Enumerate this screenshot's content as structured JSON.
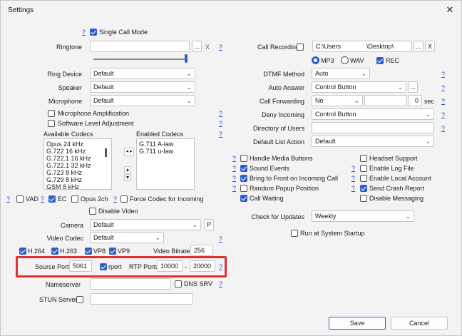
{
  "window": {
    "title": "Settings",
    "close_glyph": "✕"
  },
  "help_glyph": "?",
  "single_call_mode": {
    "label": "Single Call Mode",
    "checked": true
  },
  "ringtone": {
    "label": "Ringtone",
    "value": "",
    "browse": "...",
    "clear": "X"
  },
  "ring_device": {
    "label": "Ring Device",
    "value": "Default"
  },
  "speaker": {
    "label": "Speaker",
    "value": "Default"
  },
  "microphone": {
    "label": "Microphone",
    "value": "Default"
  },
  "mic_amplification": {
    "label": "Microphone Amplification",
    "checked": false
  },
  "software_level": {
    "label": "Software Level Adjustment",
    "checked": false
  },
  "available_codecs": {
    "label": "Available Codecs",
    "items": [
      "Opus 24 kHz",
      "G.722 16 kHz",
      "G.722.1 16 kHz",
      "G.722.1 32 kHz",
      "G.723 8 kHz",
      "G.729 8 kHz",
      "GSM 8 kHz"
    ]
  },
  "enabled_codecs": {
    "label": "Enabled Codecs",
    "items": [
      "G.711 A-law",
      "G.711 u-law"
    ]
  },
  "move_buttons": {
    "left_right": "◂ ▸",
    "up": "▴",
    "down": "▾"
  },
  "vad": {
    "label": "VAD",
    "checked": false
  },
  "ec": {
    "label": "EC",
    "checked": true
  },
  "opus2ch": {
    "label": "Opus 2ch",
    "checked": false
  },
  "force_codec": {
    "label": "Force Codec for Incoming",
    "checked": false
  },
  "disable_video": {
    "label": "Disable Video",
    "checked": false
  },
  "camera": {
    "label": "Camera",
    "value": "Default",
    "p_button": "P"
  },
  "video_codec": {
    "label": "Video Codec",
    "value": "Default"
  },
  "video_codecs": [
    {
      "label": "H.264",
      "checked": true
    },
    {
      "label": "H.263",
      "checked": true
    },
    {
      "label": "VP8",
      "checked": true
    },
    {
      "label": "VP9",
      "checked": true
    }
  ],
  "video_bitrate": {
    "label": "Video Bitrate",
    "value": "256"
  },
  "source_port": {
    "label": "Source Port",
    "value": "5061"
  },
  "rport": {
    "label": "rport",
    "checked": true
  },
  "rtp_ports": {
    "label": "RTP Ports",
    "from": "10000",
    "sep": "-",
    "to": "20000"
  },
  "nameserver": {
    "label": "Nameserver",
    "value": ""
  },
  "dns_srv": {
    "label": "DNS SRV",
    "checked": false
  },
  "stun_server": {
    "label": "STUN Server",
    "checked": false,
    "value": ""
  },
  "call_recording": {
    "label": "Call Recording",
    "checked": false,
    "path_prefix": "C:\\Users",
    "path_suffix": "\\Desktop\\",
    "browse": "...",
    "clear": "X"
  },
  "recording_format": {
    "mp3": "MP3",
    "wav": "WAV",
    "selected": "MP3"
  },
  "rec": {
    "label": "REC",
    "checked": true
  },
  "dtmf_method": {
    "label": "DTMF Method",
    "value": "Auto"
  },
  "auto_answer": {
    "label": "Auto Answer",
    "value": "Control Button",
    "browse": "..."
  },
  "call_forwarding": {
    "label": "Call Forwarding",
    "value": "No",
    "number": "",
    "seconds": "0",
    "unit": "sec"
  },
  "deny_incoming": {
    "label": "Deny Incoming",
    "value": "Control Button"
  },
  "directory_of_users": {
    "label": "Directory of Users",
    "value": ""
  },
  "default_list_action": {
    "label": "Default List Action",
    "value": "Default"
  },
  "options_left": [
    {
      "label": "Handle Media Buttons",
      "checked": false
    },
    {
      "label": "Sound Events",
      "checked": true
    },
    {
      "label": "Bring to Front on Incoming Call",
      "checked": true
    },
    {
      "label": "Random Popup Position",
      "checked": false
    },
    {
      "label": "Call Waiting",
      "checked": true
    }
  ],
  "options_right": [
    {
      "label": "Headset Support",
      "checked": false
    },
    {
      "label": "Enable Log File",
      "checked": false
    },
    {
      "label": "Enable Local Account",
      "checked": false
    },
    {
      "label": "Send Crash Report",
      "checked": true
    },
    {
      "label": "Disable Messaging",
      "checked": false
    }
  ],
  "check_for_updates": {
    "label": "Check for Updates",
    "value": "Weekly"
  },
  "run_at_startup": {
    "label": "Run at System Startup",
    "checked": false
  },
  "footer": {
    "save": "Save",
    "cancel": "Cancel"
  },
  "colors": {
    "accent": "#2f5fc9",
    "highlight": "#e03131",
    "help_link": "#2f54d6"
  }
}
